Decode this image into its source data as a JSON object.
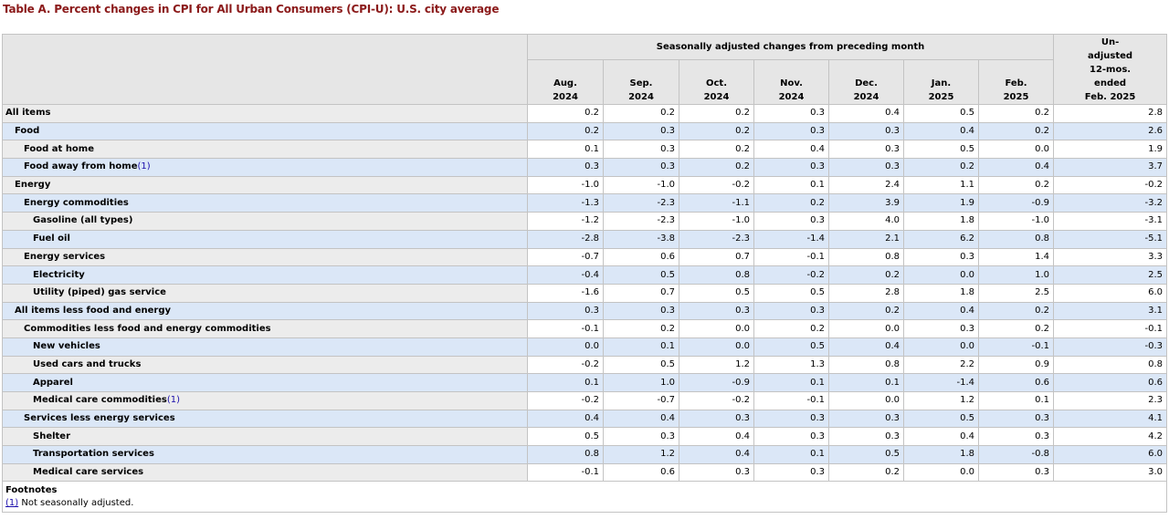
{
  "title": "Table A. Percent changes in CPI for All Urban Consumers (CPI-U): U.S. city average",
  "header": {
    "span_label": "Seasonally adjusted changes from preceding month",
    "months": [
      {
        "m": "Aug.",
        "y": "2024"
      },
      {
        "m": "Sep.",
        "y": "2024"
      },
      {
        "m": "Oct.",
        "y": "2024"
      },
      {
        "m": "Nov.",
        "y": "2024"
      },
      {
        "m": "Dec.",
        "y": "2024"
      },
      {
        "m": "Jan.",
        "y": "2025"
      },
      {
        "m": "Feb.",
        "y": "2025"
      }
    ],
    "unadjusted": [
      "Un-",
      "adjusted",
      "12-mos.",
      "ended",
      "Feb. 2025"
    ]
  },
  "rows": [
    {
      "label": "All items",
      "indent": 0,
      "fn": "",
      "values": [
        "0.2",
        "0.2",
        "0.2",
        "0.3",
        "0.4",
        "0.5",
        "0.2",
        "2.8"
      ]
    },
    {
      "label": "Food",
      "indent": 1,
      "fn": "",
      "values": [
        "0.2",
        "0.3",
        "0.2",
        "0.3",
        "0.3",
        "0.4",
        "0.2",
        "2.6"
      ]
    },
    {
      "label": "Food at home",
      "indent": 2,
      "fn": "",
      "values": [
        "0.1",
        "0.3",
        "0.2",
        "0.4",
        "0.3",
        "0.5",
        "0.0",
        "1.9"
      ]
    },
    {
      "label": "Food away from home",
      "indent": 2,
      "fn": "(1)",
      "values": [
        "0.3",
        "0.3",
        "0.2",
        "0.3",
        "0.3",
        "0.2",
        "0.4",
        "3.7"
      ]
    },
    {
      "label": "Energy",
      "indent": 1,
      "fn": "",
      "values": [
        "-1.0",
        "-1.0",
        "-0.2",
        "0.1",
        "2.4",
        "1.1",
        "0.2",
        "-0.2"
      ]
    },
    {
      "label": "Energy commodities",
      "indent": 2,
      "fn": "",
      "values": [
        "-1.3",
        "-2.3",
        "-1.1",
        "0.2",
        "3.9",
        "1.9",
        "-0.9",
        "-3.2"
      ]
    },
    {
      "label": "Gasoline (all types)",
      "indent": 3,
      "fn": "",
      "values": [
        "-1.2",
        "-2.3",
        "-1.0",
        "0.3",
        "4.0",
        "1.8",
        "-1.0",
        "-3.1"
      ]
    },
    {
      "label": "Fuel oil",
      "indent": 3,
      "fn": "",
      "values": [
        "-2.8",
        "-3.8",
        "-2.3",
        "-1.4",
        "2.1",
        "6.2",
        "0.8",
        "-5.1"
      ]
    },
    {
      "label": "Energy services",
      "indent": 2,
      "fn": "",
      "values": [
        "-0.7",
        "0.6",
        "0.7",
        "-0.1",
        "0.8",
        "0.3",
        "1.4",
        "3.3"
      ]
    },
    {
      "label": "Electricity",
      "indent": 3,
      "fn": "",
      "values": [
        "-0.4",
        "0.5",
        "0.8",
        "-0.2",
        "0.2",
        "0.0",
        "1.0",
        "2.5"
      ]
    },
    {
      "label": "Utility (piped) gas service",
      "indent": 3,
      "fn": "",
      "values": [
        "-1.6",
        "0.7",
        "0.5",
        "0.5",
        "2.8",
        "1.8",
        "2.5",
        "6.0"
      ]
    },
    {
      "label": "All items less food and energy",
      "indent": 1,
      "fn": "",
      "values": [
        "0.3",
        "0.3",
        "0.3",
        "0.3",
        "0.2",
        "0.4",
        "0.2",
        "3.1"
      ]
    },
    {
      "label": "Commodities less food and energy commodities",
      "indent": 2,
      "fn": "",
      "values": [
        "-0.1",
        "0.2",
        "0.0",
        "0.2",
        "0.0",
        "0.3",
        "0.2",
        "-0.1"
      ]
    },
    {
      "label": "New vehicles",
      "indent": 3,
      "fn": "",
      "values": [
        "0.0",
        "0.1",
        "0.0",
        "0.5",
        "0.4",
        "0.0",
        "-0.1",
        "-0.3"
      ]
    },
    {
      "label": "Used cars and trucks",
      "indent": 3,
      "fn": "",
      "values": [
        "-0.2",
        "0.5",
        "1.2",
        "1.3",
        "0.8",
        "2.2",
        "0.9",
        "0.8"
      ]
    },
    {
      "label": "Apparel",
      "indent": 3,
      "fn": "",
      "values": [
        "0.1",
        "1.0",
        "-0.9",
        "0.1",
        "0.1",
        "-1.4",
        "0.6",
        "0.6"
      ]
    },
    {
      "label": "Medical care commodities",
      "indent": 3,
      "fn": "(1)",
      "values": [
        "-0.2",
        "-0.7",
        "-0.2",
        "-0.1",
        "0.0",
        "1.2",
        "0.1",
        "2.3"
      ]
    },
    {
      "label": "Services less energy services",
      "indent": 2,
      "fn": "",
      "values": [
        "0.4",
        "0.4",
        "0.3",
        "0.3",
        "0.3",
        "0.5",
        "0.3",
        "4.1"
      ]
    },
    {
      "label": "Shelter",
      "indent": 3,
      "fn": "",
      "values": [
        "0.5",
        "0.3",
        "0.4",
        "0.3",
        "0.3",
        "0.4",
        "0.3",
        "4.2"
      ]
    },
    {
      "label": "Transportation services",
      "indent": 3,
      "fn": "",
      "values": [
        "0.8",
        "1.2",
        "0.4",
        "0.1",
        "0.5",
        "1.8",
        "-0.8",
        "6.0"
      ]
    },
    {
      "label": "Medical care services",
      "indent": 3,
      "fn": "",
      "values": [
        "-0.1",
        "0.6",
        "0.3",
        "0.3",
        "0.2",
        "0.0",
        "0.3",
        "3.0"
      ]
    }
  ],
  "footnotes": {
    "heading": "Footnotes",
    "items": [
      {
        "ref": "(1)",
        "text": " Not seasonally adjusted."
      }
    ]
  },
  "colors": {
    "title": "#8b1a1a",
    "stripe": "#dbe7f7",
    "label_bg": "#ececec",
    "header_bg": "#e6e6e6"
  }
}
